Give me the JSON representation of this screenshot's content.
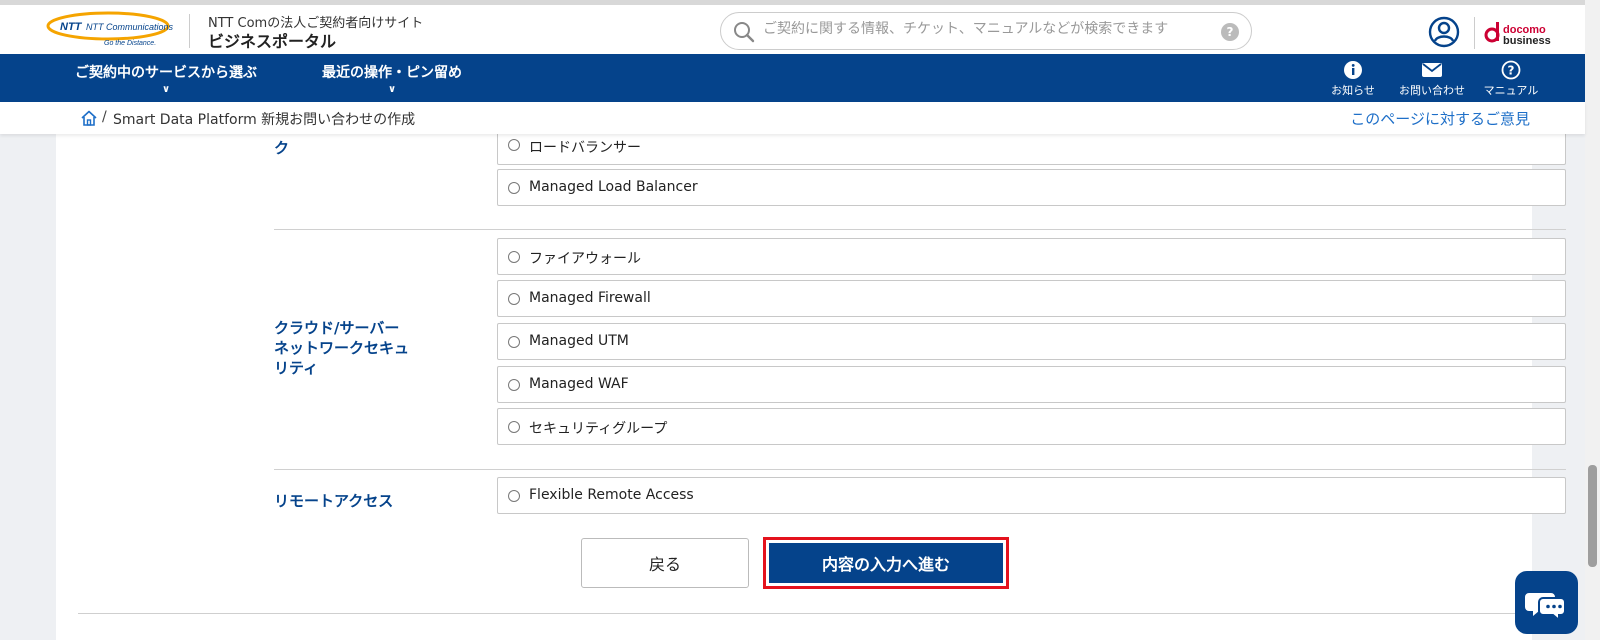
{
  "header": {
    "brand_company": "NTT Communications",
    "brand_tagline": "Go the Distance.",
    "site_subtitle": "NTT Comの法人ご契約者向けサイト",
    "site_title": "ビジネスポータル",
    "search_placeholder": "ご契約に関する情報、チケット、マニュアルなどが検索できます",
    "docomo_brand_top": "docomo",
    "docomo_brand_bottom": "business"
  },
  "nav": {
    "left_items": [
      {
        "label": "ご契約中のサービスから選ぶ"
      },
      {
        "label": "最近の操作・ピン留め"
      }
    ],
    "right_items": [
      {
        "label": "お知らせ",
        "icon": "info-icon"
      },
      {
        "label": "お問い合わせ",
        "icon": "mail-icon"
      },
      {
        "label": "マニュアル",
        "icon": "question-icon"
      }
    ]
  },
  "breadcrumb": {
    "separator": "/",
    "current": "Smart Data Platform 新規お問い合わせの作成",
    "feedback_link": "このページに対するご意見"
  },
  "form": {
    "groups": [
      {
        "label": "ク",
        "options": [
          "ロードバランサー",
          "Managed Load Balancer"
        ]
      },
      {
        "label": "クラウド/サーバー ネットワークセキュリティ",
        "options": [
          "ファイアウォール",
          "Managed Firewall",
          "Managed UTM",
          "Managed WAF",
          "セキュリティグループ"
        ]
      },
      {
        "label": "リモートアクセス",
        "options": [
          "Flexible Remote Access"
        ]
      }
    ],
    "back_button": "戻る",
    "next_button": "内容の入力へ進む"
  },
  "colors": {
    "brand_navy": "#05438b",
    "link_blue": "#1e6fc8",
    "highlight_red": "#e4121d",
    "docomo_red": "#cc0033"
  }
}
